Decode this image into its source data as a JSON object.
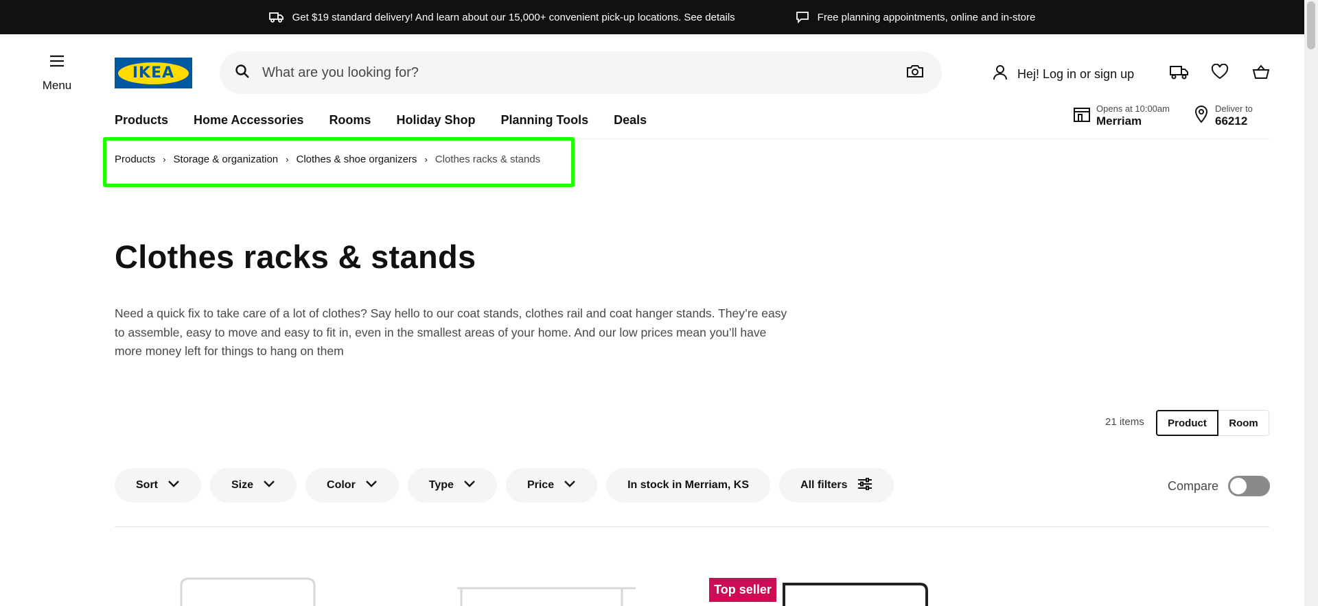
{
  "promo": {
    "delivery": "Get $19 standard delivery! And learn about our 15,000+ convenient pick-up locations. See details",
    "planning": "Free planning appointments, online and in-store"
  },
  "header": {
    "menu_label": "Menu",
    "logo_text": "IKEA",
    "search_placeholder": "What are you looking for?",
    "login_label": "Hej! Log in or sign up"
  },
  "nav": {
    "items": [
      "Products",
      "Home Accessories",
      "Rooms",
      "Holiday Shop",
      "Planning Tools",
      "Deals"
    ]
  },
  "store": {
    "hours": "Opens at 10:00am",
    "name": "Merriam"
  },
  "delivery": {
    "label": "Deliver to",
    "zip": "66212"
  },
  "breadcrumb": {
    "items": [
      "Products",
      "Storage & organization",
      "Clothes & shoe organizers",
      "Clothes racks & stands"
    ]
  },
  "page": {
    "title": "Clothes racks & stands",
    "description": "Need a quick fix to take care of a lot of clothes? Say hello to our coat stands, clothes rail and coat hanger stands. They’re easy to assemble, easy to move and easy to fit in, even in the smallest areas of your home. And our low prices mean you’ll have more money left for things to hang on them"
  },
  "results": {
    "count": "21 items",
    "view_product": "Product",
    "view_room": "Room"
  },
  "filters": {
    "items": [
      "Sort",
      "Size",
      "Color",
      "Type",
      "Price",
      "In stock in Merriam, KS",
      "All filters"
    ]
  },
  "compare": {
    "label": "Compare",
    "on": false
  },
  "products": {
    "badge": "Top seller"
  },
  "colors": {
    "brand_blue": "#0058a3",
    "brand_yellow": "#ffdb00",
    "highlight": "#22ff00",
    "badge": "#cc0d55"
  }
}
